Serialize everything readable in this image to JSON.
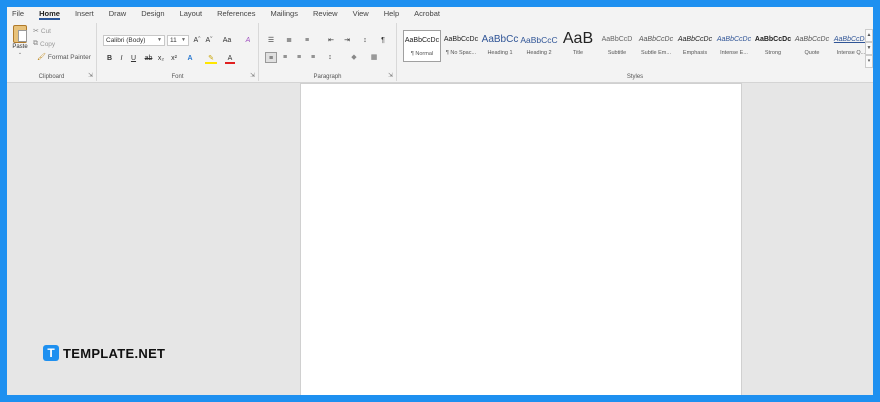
{
  "menu": {
    "tabs": [
      {
        "label": "File"
      },
      {
        "label": "Home"
      },
      {
        "label": "Insert"
      },
      {
        "label": "Draw"
      },
      {
        "label": "Design"
      },
      {
        "label": "Layout"
      },
      {
        "label": "References"
      },
      {
        "label": "Mailings"
      },
      {
        "label": "Review"
      },
      {
        "label": "View"
      },
      {
        "label": "Help"
      },
      {
        "label": "Acrobat"
      }
    ],
    "active_tab": "Home",
    "accent_color": "#2b579a"
  },
  "clipboard": {
    "paste_label": "Paste",
    "cut_label": "Cut",
    "copy_label": "Copy",
    "format_painter_label": "Format Painter",
    "group_label": "Clipboard"
  },
  "font": {
    "font_name": "Calibri (Body)",
    "font_size": "11",
    "grow": "Aˆ",
    "shrink": "Aˇ",
    "change_case": "Aa",
    "clear": "A",
    "bold": "B",
    "italic": "I",
    "underline": "U",
    "strike": "ab",
    "subscript": "x₂",
    "superscript": "x²",
    "text_effects": "A",
    "highlight": "✎",
    "font_color": "A",
    "group_label": "Font"
  },
  "paragraph": {
    "bullets": "☰",
    "numbering": "≣",
    "multilevel": "≡",
    "decrease_indent": "⇤",
    "increase_indent": "⇥",
    "sort": "↕",
    "pilcrow": "¶",
    "align_left": "≡",
    "align_center": "≡",
    "align_right": "≡",
    "justify": "≡",
    "line_spacing": "↕",
    "shading": "◆",
    "borders": "▦",
    "group_label": "Paragraph"
  },
  "styles": {
    "group_label": "Styles",
    "items": [
      {
        "sample": "AaBbCcDc",
        "name": "¶ Normal"
      },
      {
        "sample": "AaBbCcDc",
        "name": "¶ No Spac..."
      },
      {
        "sample": "AaBbCc",
        "name": "Heading 1"
      },
      {
        "sample": "AaBbCcC",
        "name": "Heading 2"
      },
      {
        "sample": "AaB",
        "name": "Title"
      },
      {
        "sample": "AaBbCcD",
        "name": "Subtitle"
      },
      {
        "sample": "AaBbCcDc",
        "name": "Subtle Em..."
      },
      {
        "sample": "AaBbCcDc",
        "name": "Emphasis"
      },
      {
        "sample": "AaBbCcDc",
        "name": "Intense E..."
      },
      {
        "sample": "AaBbCcDc",
        "name": "Strong"
      },
      {
        "sample": "AaBbCcDc",
        "name": "Quote"
      },
      {
        "sample": "AaBbCcDc",
        "name": "Intense Q..."
      }
    ]
  },
  "watermark": {
    "badge": "T",
    "text": "TEMPLATE.NET",
    "color": "#1e90f0"
  }
}
